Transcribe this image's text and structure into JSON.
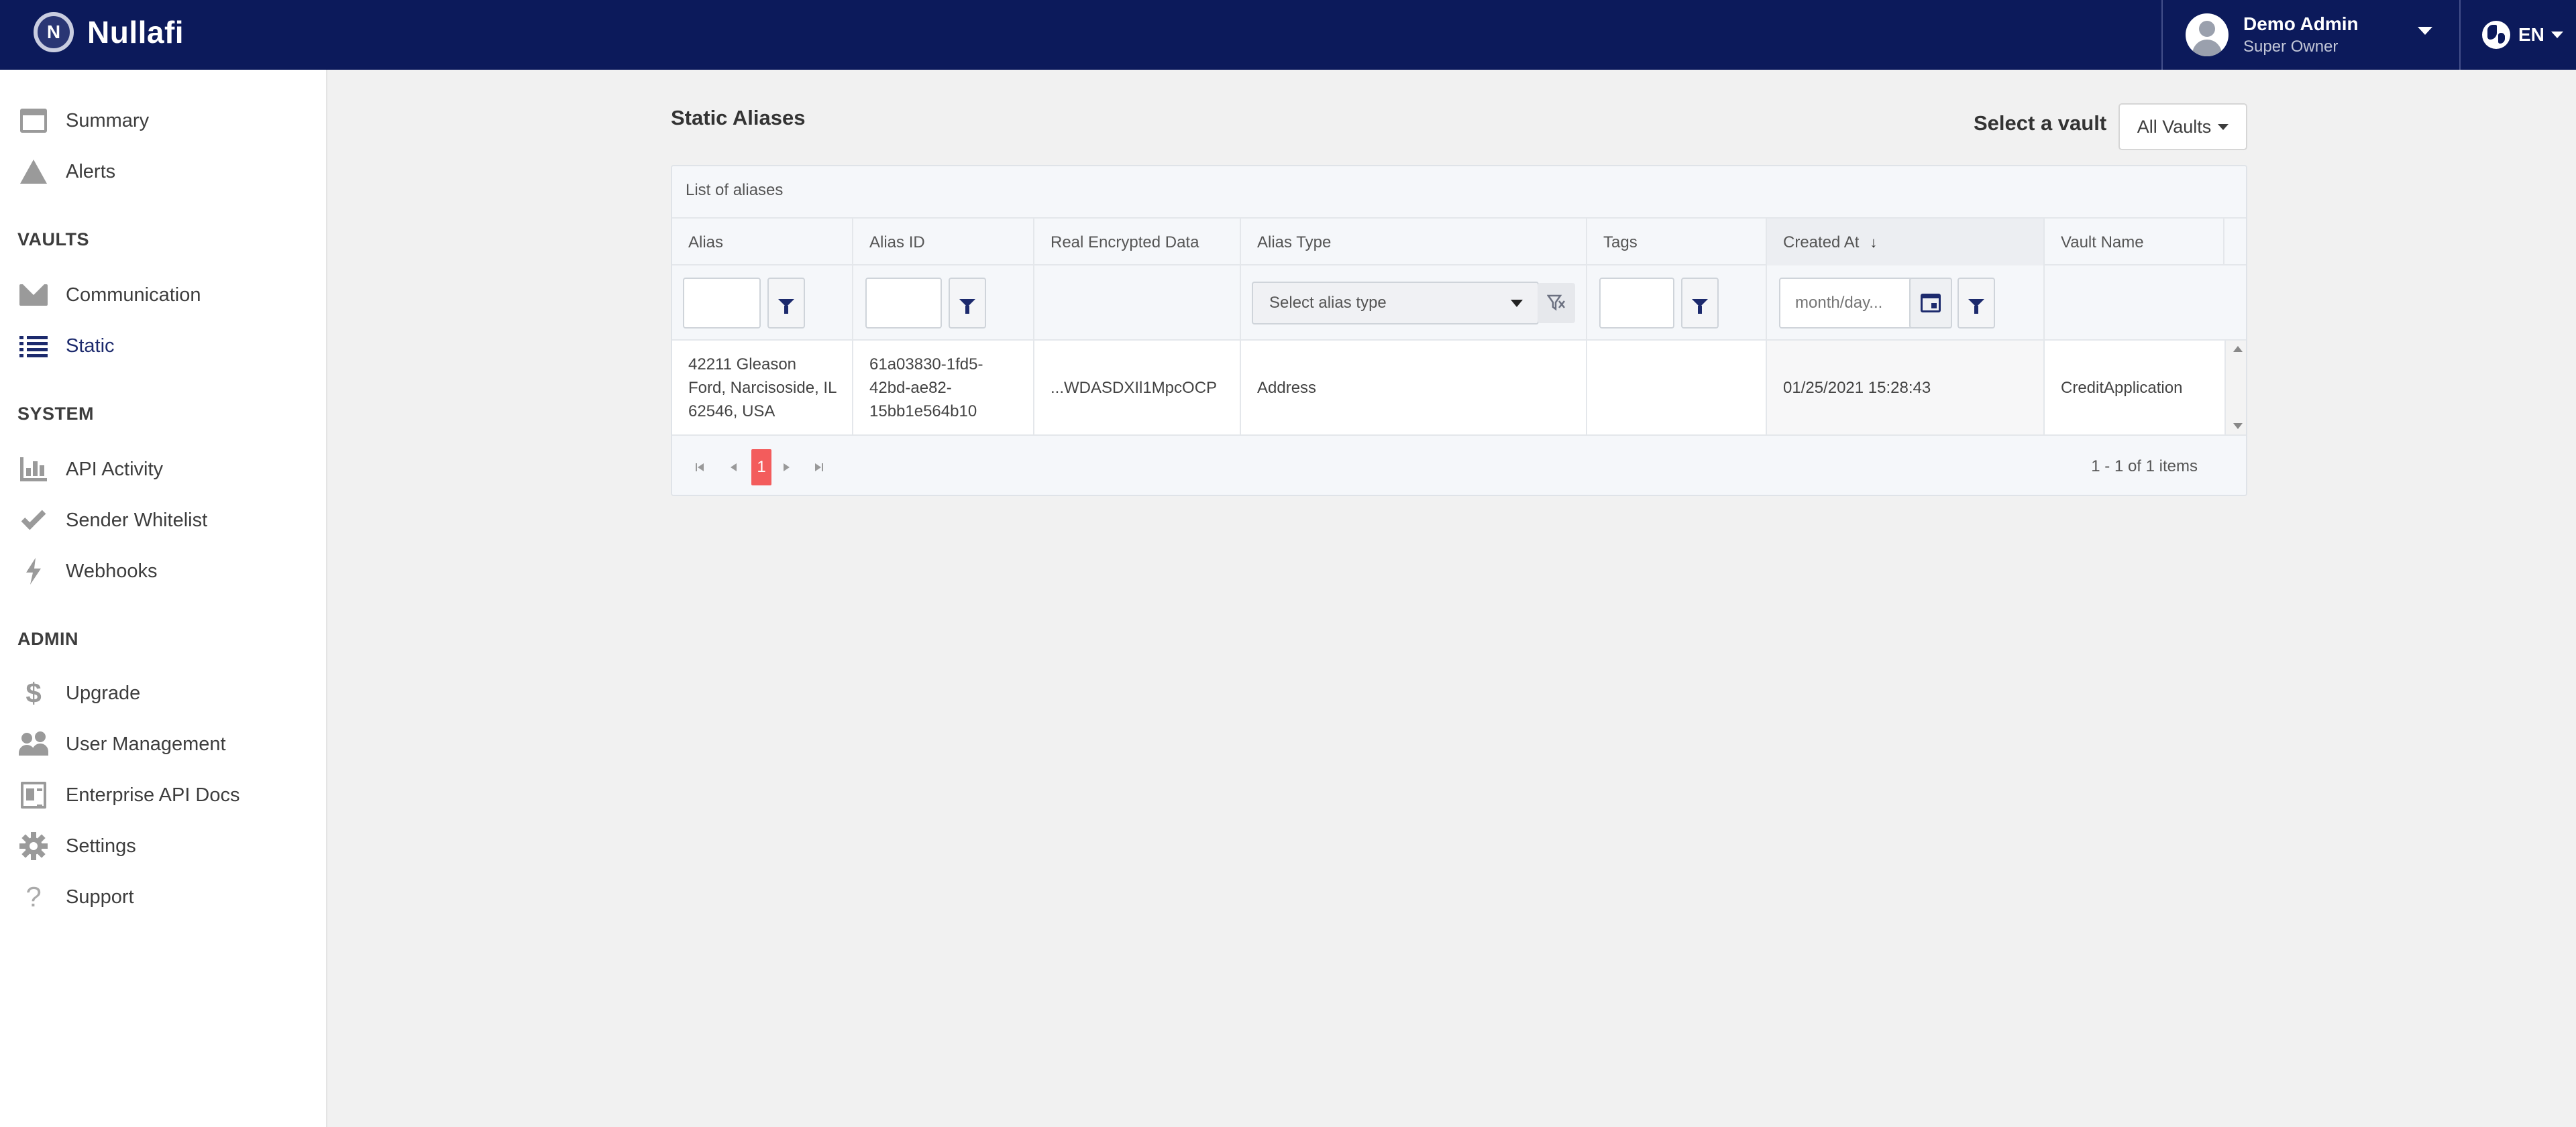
{
  "header": {
    "brand": "Nullafi",
    "brand_logo_letter": "N",
    "user_name": "Demo Admin",
    "user_role": "Super Owner",
    "language": "EN"
  },
  "sidebar": {
    "top_items": [
      {
        "label": "Summary",
        "icon": "window-icon"
      },
      {
        "label": "Alerts",
        "icon": "alert-icon"
      }
    ],
    "sections": [
      {
        "title": "VAULTS",
        "items": [
          {
            "label": "Communication",
            "icon": "mail-icon"
          },
          {
            "label": "Static",
            "icon": "list-icon",
            "active": true
          }
        ]
      },
      {
        "title": "SYSTEM",
        "items": [
          {
            "label": "API Activity",
            "icon": "bar-chart-icon"
          },
          {
            "label": "Sender Whitelist",
            "icon": "check-icon"
          },
          {
            "label": "Webhooks",
            "icon": "bolt-icon"
          }
        ]
      },
      {
        "title": "ADMIN",
        "items": [
          {
            "label": "Upgrade",
            "icon": "dollar-icon"
          },
          {
            "label": "User Management",
            "icon": "users-icon"
          },
          {
            "label": "Enterprise API Docs",
            "icon": "document-icon"
          },
          {
            "label": "Settings",
            "icon": "gear-icon"
          },
          {
            "label": "Support",
            "icon": "question-icon"
          }
        ]
      }
    ]
  },
  "main": {
    "page_title": "Static Aliases",
    "vault_label": "Select a vault",
    "vault_selected": "All Vaults"
  },
  "grid": {
    "caption": "List of aliases",
    "columns": [
      "Alias",
      "Alias ID",
      "Real Encrypted Data",
      "Alias Type",
      "Tags",
      "Created At",
      "Vault Name"
    ],
    "sorted_column": "Created At",
    "filters": {
      "alias_type_placeholder": "Select alias type",
      "date_placeholder": "month/day..."
    },
    "rows": [
      {
        "alias_lines": [
          "42211 Gleason",
          "Ford, Narcisoside, IL",
          "62546, USA"
        ],
        "alias_id_lines": [
          "61a03830-1fd5-",
          "42bd-ae82-",
          "15bb1e564b10"
        ],
        "real_data": "...WDASDXIl1MpcOCP",
        "alias_type": "Address",
        "tags": "",
        "created_at": "01/25/2021 15:28:43",
        "vault_name": "CreditApplication"
      }
    ],
    "pager": {
      "current_page": "1",
      "info": "1 - 1 of 1 items"
    }
  },
  "colors": {
    "topbar": "#0c1a5b",
    "active_nav": "#1c2a6d",
    "current_page": "#f35c5c"
  }
}
